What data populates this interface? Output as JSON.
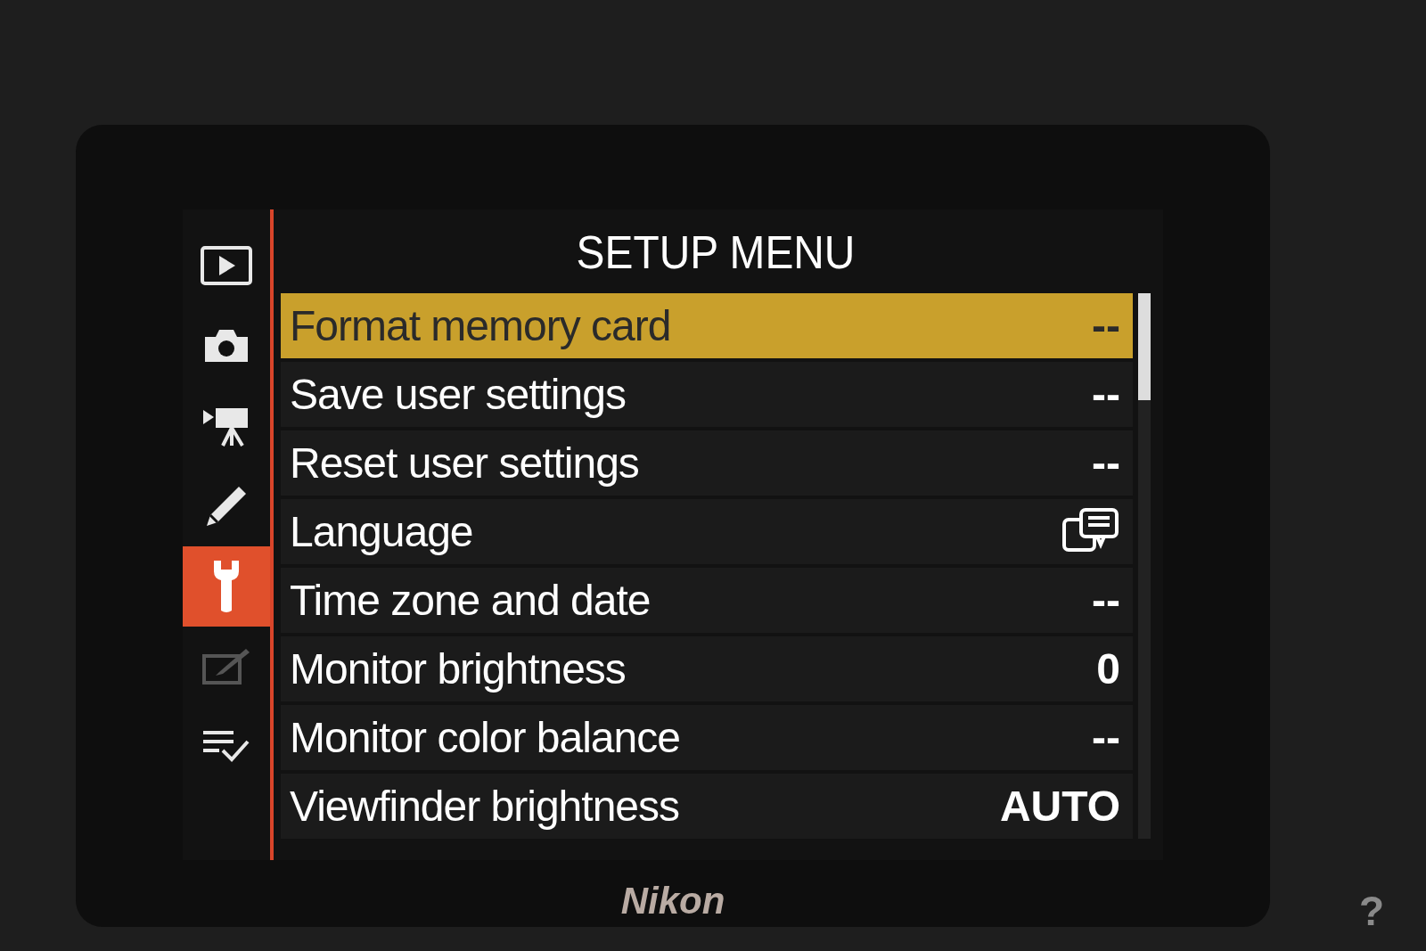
{
  "tabs": [
    {
      "kind": "playback",
      "selected": false,
      "disabled": false
    },
    {
      "kind": "photo",
      "selected": false,
      "disabled": false
    },
    {
      "kind": "movie",
      "selected": false,
      "disabled": false
    },
    {
      "kind": "custom",
      "selected": false,
      "disabled": false
    },
    {
      "kind": "setup",
      "selected": true,
      "disabled": false
    },
    {
      "kind": "retouch",
      "selected": false,
      "disabled": true
    },
    {
      "kind": "my_menu",
      "selected": false,
      "disabled": false
    }
  ],
  "title": "SETUP MENU",
  "items": [
    {
      "label": "Format memory card",
      "kind": "text",
      "value": "--",
      "selected": true
    },
    {
      "label": "Save user settings",
      "kind": "text",
      "value": "--",
      "selected": false
    },
    {
      "label": "Reset user settings",
      "kind": "text",
      "value": "--",
      "selected": false
    },
    {
      "label": "Language",
      "kind": "icon",
      "selected": false
    },
    {
      "label": "Time zone and date",
      "kind": "text",
      "value": "--",
      "selected": false
    },
    {
      "label": "Monitor brightness",
      "kind": "text",
      "value": "0",
      "selected": false
    },
    {
      "label": "Monitor color balance",
      "kind": "text",
      "value": "--",
      "selected": false
    },
    {
      "label": "Viewfinder brightness",
      "kind": "text",
      "value": "AUTO",
      "selected": false
    }
  ],
  "brand": "Nikon",
  "help_key": "?"
}
